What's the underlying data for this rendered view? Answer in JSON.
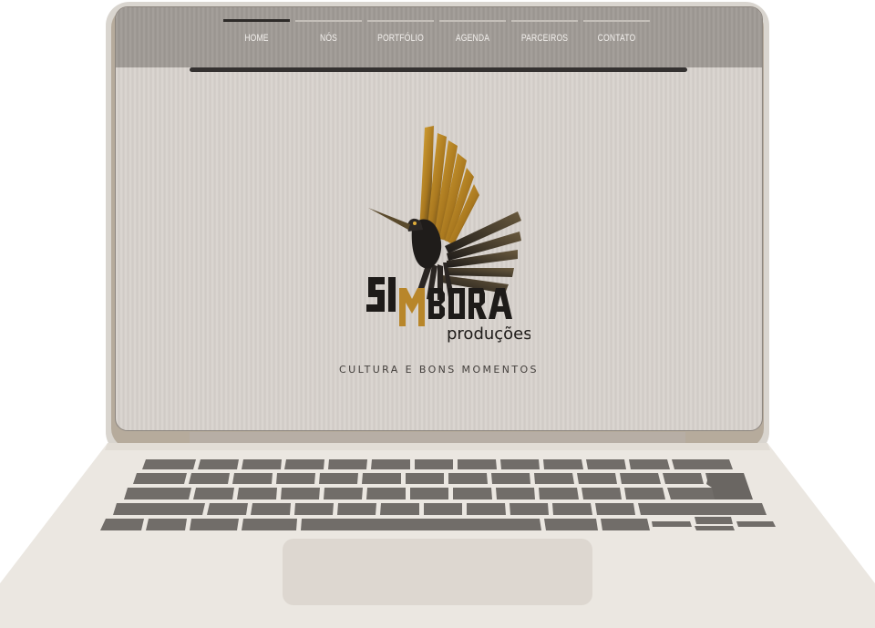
{
  "nav": {
    "items": [
      {
        "label": "HOME"
      },
      {
        "label": "NÓS"
      },
      {
        "label": "PORTFÓLIO"
      },
      {
        "label": "AGENDA"
      },
      {
        "label": "PARCEIROS"
      },
      {
        "label": "CONTATO"
      }
    ],
    "active_index": 0
  },
  "logo": {
    "name": "SIMBORA",
    "subtitle": "produções",
    "icon": "hummingbird-logo"
  },
  "tagline": "CULTURA E BONS MOMENTOS",
  "colors": {
    "page_bg": "#d6d0cb",
    "header_bg": "#9e9994",
    "logo_gold": "#c9972a",
    "logo_dark": "#1e1b19",
    "laptop_body": "#ebe7e1",
    "keys": "#716d69"
  }
}
